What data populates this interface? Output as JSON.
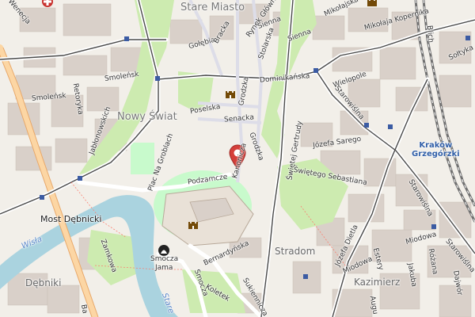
{
  "districts": {
    "stare_miasto": "Stare Miasto",
    "nowy_swiat": "Nowy Świat",
    "stradom": "Stradom",
    "kazimierz": "Kazimierz",
    "debniki": "Dębniki"
  },
  "station": {
    "line1": "Kraków",
    "line2": "Grzegórzki"
  },
  "places": {
    "most_debnicki": "Most Dębnicki",
    "smocza_jama_1": "Smocza",
    "smocza_jama_2": "Jama"
  },
  "river": {
    "wisla": "Wisła",
    "stare": "Stare"
  },
  "streets": {
    "wenecja": "Wenecja",
    "golebia": "Gołębia",
    "bracka": "Bracka",
    "rynek_glowny": "Rynek Główny",
    "sienna": "Sienna",
    "sienna2": "Sienna",
    "stolarska": "Stolarska",
    "mikolajska": "Mikołajska",
    "mikolaja_kopernika": "Mikołaja Kopernika",
    "blich": "Blich",
    "soltyka": "Sołtyka",
    "smolensk1": "Smoleńsk",
    "smolensk2": "Smoleńsk",
    "retoryka": "Retoryka",
    "dominikanska": "Dominikańska",
    "wielopole": "Wielopole",
    "poselska": "Poselska",
    "grodzka": "Grodzka",
    "senacka": "Senacka",
    "starowislna": "Starowiślna",
    "jablonowskich": "Jabłonowskich",
    "grodzka2": "Grodzka",
    "kanonicza": "Kanonicza",
    "swietej_gertrudy": "Świętej Gertrudy",
    "jozefa_sarego": "Józefa Sarego",
    "swietego_sebastiana": "Świętego Sebastiana",
    "plac_na_groblach": "Plac Na Groblach",
    "podzamcze": "Podzamcze",
    "zamkowa": "Zamkowa",
    "bernardynska": "Bernardyńska",
    "smocza": "Smocza",
    "koletek": "Koletek",
    "sukiennicza": "Sukiennicza",
    "jozefa_dietla": "Józefa Dietla",
    "miodowa": "Miodowa",
    "miodowa2": "Miodowa",
    "estery": "Estery",
    "jakuba": "Jakuba",
    "starowislna2": "Starowiślna",
    "dajwor": "Dajwór",
    "starowislna3": "Starowiślna",
    "rozana": "Różana",
    "barska": "Ba",
    "augustianska": "Augu"
  },
  "colors": {
    "background": "#f2efe9",
    "buildings": "#d9d0c9",
    "park": "#c8facc",
    "grass": "#cdebb0",
    "water": "#aad3df",
    "main_road": "#fcd6a4",
    "railway": "#707070",
    "pedestrian": "#dddde8",
    "marker": "#d43f3a"
  },
  "icons": {
    "marker": "map-pin-icon",
    "castle": "castle-icon",
    "hospital": "hospital-icon"
  }
}
